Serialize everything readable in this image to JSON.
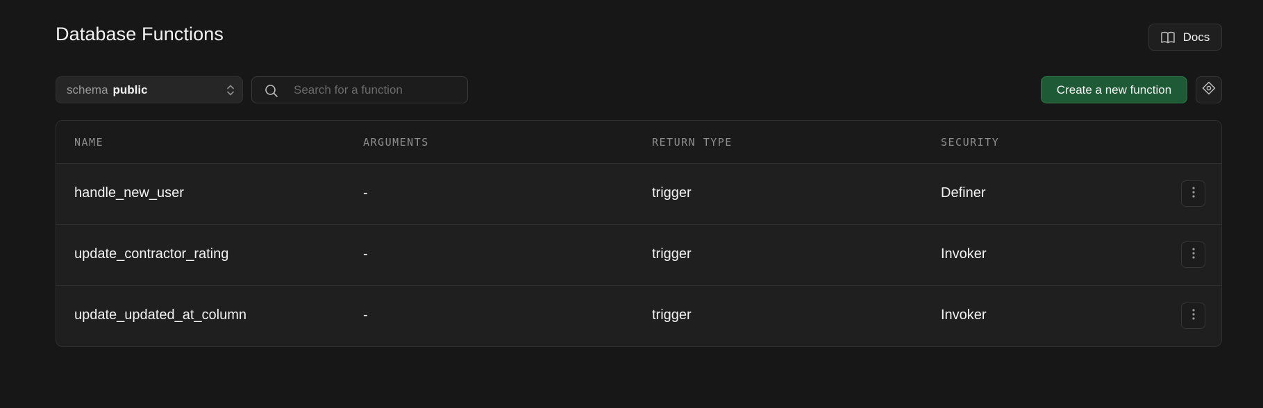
{
  "header": {
    "title": "Database Functions",
    "docs_label": "Docs"
  },
  "toolbar": {
    "schema_label": "schema",
    "schema_value": "public",
    "search_placeholder": "Search for a function",
    "search_value": "",
    "create_label": "Create a new function"
  },
  "table": {
    "columns": [
      "NAME",
      "ARGUMENTS",
      "RETURN TYPE",
      "SECURITY"
    ],
    "rows": [
      {
        "name": "handle_new_user",
        "arguments": "-",
        "return_type": "trigger",
        "security": "Definer"
      },
      {
        "name": "update_contractor_rating",
        "arguments": "-",
        "return_type": "trigger",
        "security": "Invoker"
      },
      {
        "name": "update_updated_at_column",
        "arguments": "-",
        "return_type": "trigger",
        "security": "Invoker"
      }
    ]
  },
  "icons": {
    "docs": "book-open-icon",
    "select": "chevron-up-down-icon",
    "search": "search-icon",
    "ai": "ai-assistant-icon",
    "row_menu": "more-vertical-icon"
  },
  "colors": {
    "background": "#171717",
    "accent": "#1e5a35",
    "accent_border": "#2d7a4a"
  }
}
